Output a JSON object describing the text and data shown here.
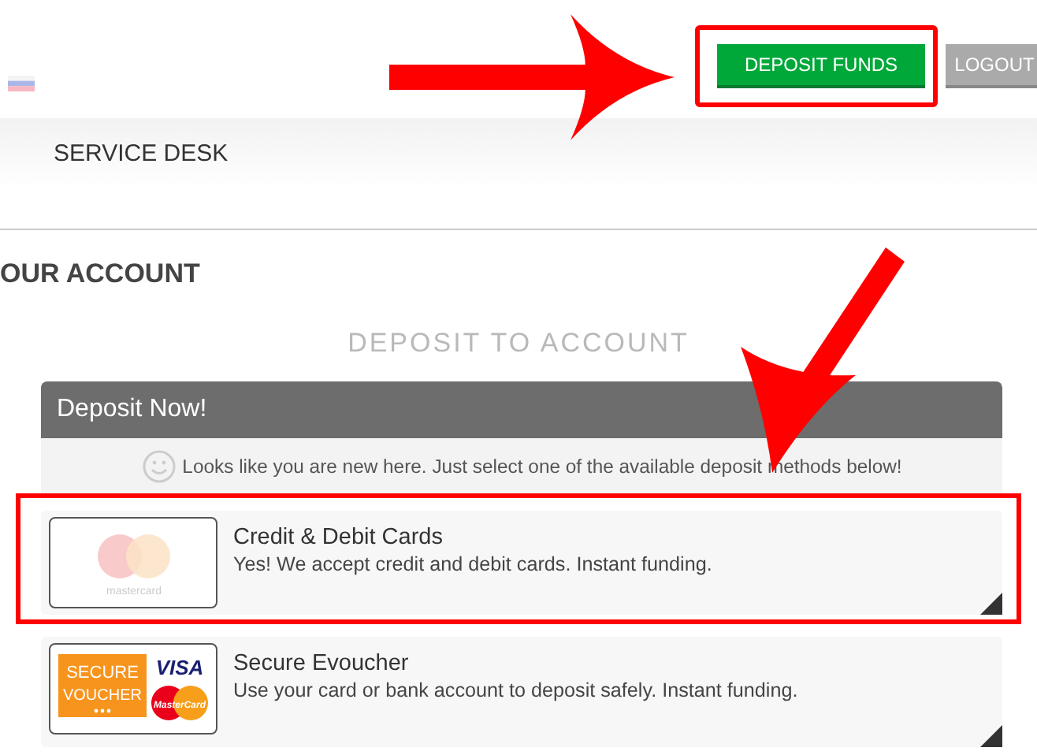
{
  "header": {
    "buttons": [
      {
        "label": "DEPOSIT FUNDS",
        "kind": "primary",
        "highlighted": true
      },
      {
        "label": "LOGOUT",
        "kind": "secondary",
        "highlighted": false
      }
    ]
  },
  "nav": {
    "items": [
      "SERVICE DESK"
    ]
  },
  "page_title": "OUR ACCOUNT",
  "section_title": "DEPOSIT TO ACCOUNT",
  "panel": {
    "title": "Deposit Now!",
    "notice": "Looks like you are new here. Just select one of the available deposit methods below!",
    "methods": [
      {
        "kind": "cards",
        "title": "Credit & Debit Cards",
        "description": "Yes! We accept credit and debit cards. Instant funding.",
        "highlighted": true,
        "logo_texts": [
          "mastercard"
        ]
      },
      {
        "kind": "voucher",
        "title": "Secure Evoucher",
        "description": "Use your card or bank account to deposit safely. Instant funding.",
        "highlighted": false,
        "logo_texts": [
          "SECURE",
          "VOUCHER",
          "VISA",
          "MasterCard"
        ]
      }
    ]
  }
}
